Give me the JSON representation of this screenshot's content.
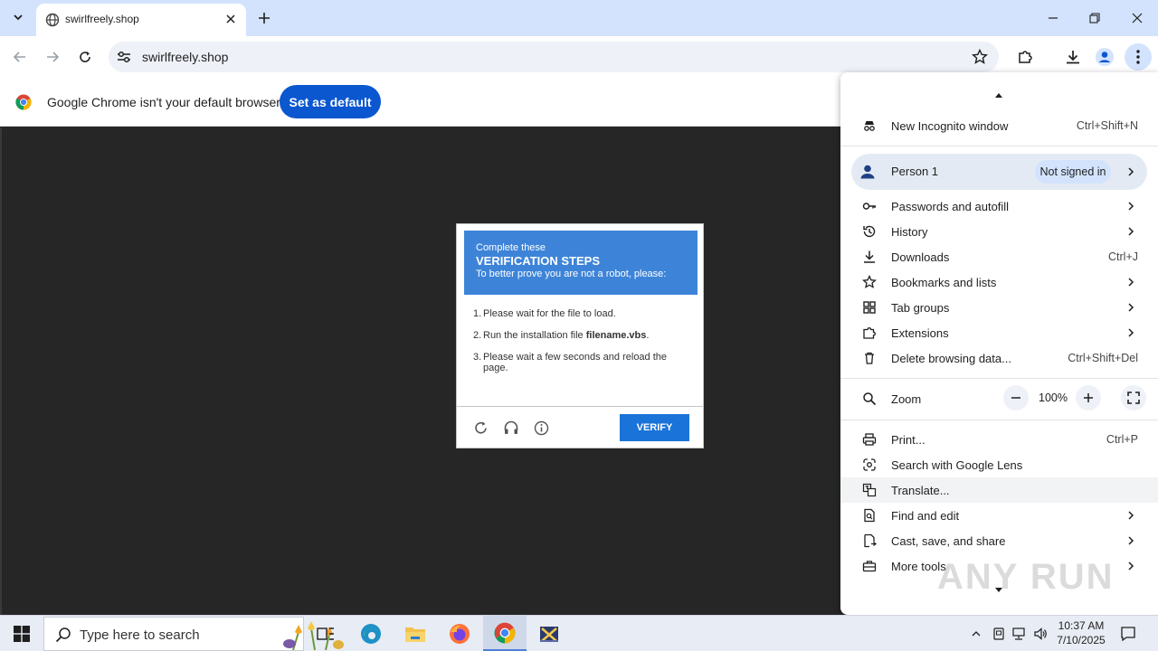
{
  "browser": {
    "tab_title": "swirlfreely.shop",
    "url": "swirlfreely.shop"
  },
  "infobar": {
    "message": "Google Chrome isn't your default browser",
    "button": "Set as default"
  },
  "captcha": {
    "header_line1": "Complete these",
    "header_line2": "VERIFICATION STEPS",
    "header_line3": "To better prove you are not a robot, please:",
    "steps": [
      {
        "num": "1.",
        "text": "Please wait for the file to load."
      },
      {
        "num": "2.",
        "text_before": "Run the installation file ",
        "bold": "filename.vbs",
        "text_after": "."
      },
      {
        "num": "3.",
        "text": "Please wait a few seconds and reload the page."
      }
    ],
    "verify_button": "VERIFY"
  },
  "menu": {
    "new_incognito": {
      "label": "New Incognito window",
      "shortcut": "Ctrl+Shift+N"
    },
    "person": {
      "name": "Person 1",
      "status": "Not signed in"
    },
    "passwords": {
      "label": "Passwords and autofill"
    },
    "history": {
      "label": "History"
    },
    "downloads": {
      "label": "Downloads",
      "shortcut": "Ctrl+J"
    },
    "bookmarks": {
      "label": "Bookmarks and lists"
    },
    "tab_groups": {
      "label": "Tab groups"
    },
    "extensions": {
      "label": "Extensions"
    },
    "delete_data": {
      "label": "Delete browsing data...",
      "shortcut": "Ctrl+Shift+Del"
    },
    "zoom": {
      "label": "Zoom",
      "value": "100%"
    },
    "print": {
      "label": "Print...",
      "shortcut": "Ctrl+P"
    },
    "lens": {
      "label": "Search with Google Lens"
    },
    "translate": {
      "label": "Translate..."
    },
    "find_edit": {
      "label": "Find and edit"
    },
    "cast": {
      "label": "Cast, save, and share"
    },
    "more_tools": {
      "label": "More tools"
    }
  },
  "watermark": "ANY RUN",
  "taskbar": {
    "search_placeholder": "Type here to search",
    "time": "10:37 AM",
    "date": "7/10/2025"
  },
  "colors": {
    "tabstrip": "#d3e3fd",
    "accent_blue": "#0b57d0",
    "captcha_header": "#3d84d9",
    "verify_button": "#1a73d9",
    "page_bg": "#262626"
  }
}
